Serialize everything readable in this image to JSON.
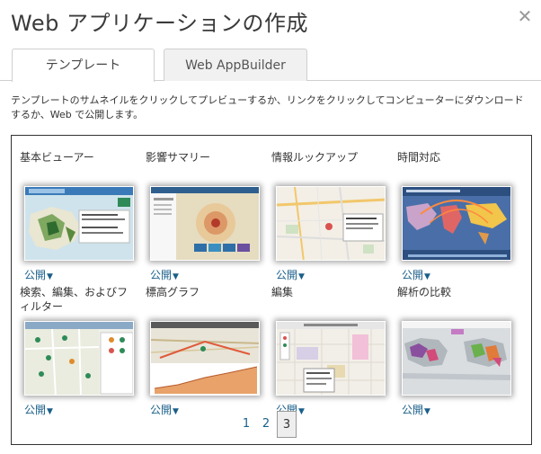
{
  "dialog": {
    "title": "Web アプリケーションの作成",
    "close_glyph": "✕"
  },
  "tabs": [
    {
      "label": "テンプレート",
      "active": true
    },
    {
      "label": "Web AppBuilder",
      "active": false
    }
  ],
  "description": "テンプレートのサムネイルをクリックしてプレビューするか、リンクをクリックしてコンピューターにダウンロードするか、Web で公開します。",
  "templates": [
    {
      "title": "基本ビューアー",
      "action": "公開"
    },
    {
      "title": "影響サマリー",
      "action": "公開"
    },
    {
      "title": "情報ルックアップ",
      "action": "公開"
    },
    {
      "title": "時間対応",
      "action": "公開"
    },
    {
      "title": "検索、編集、およびフィルター",
      "action": "公開"
    },
    {
      "title": "標高グラフ",
      "action": "公開"
    },
    {
      "title": "編集",
      "action": "公開"
    },
    {
      "title": "解析の比較",
      "action": "公開"
    }
  ],
  "pagination": {
    "pages": [
      "1",
      "2",
      "3"
    ],
    "current": "3"
  },
  "caret_glyph": "▼"
}
